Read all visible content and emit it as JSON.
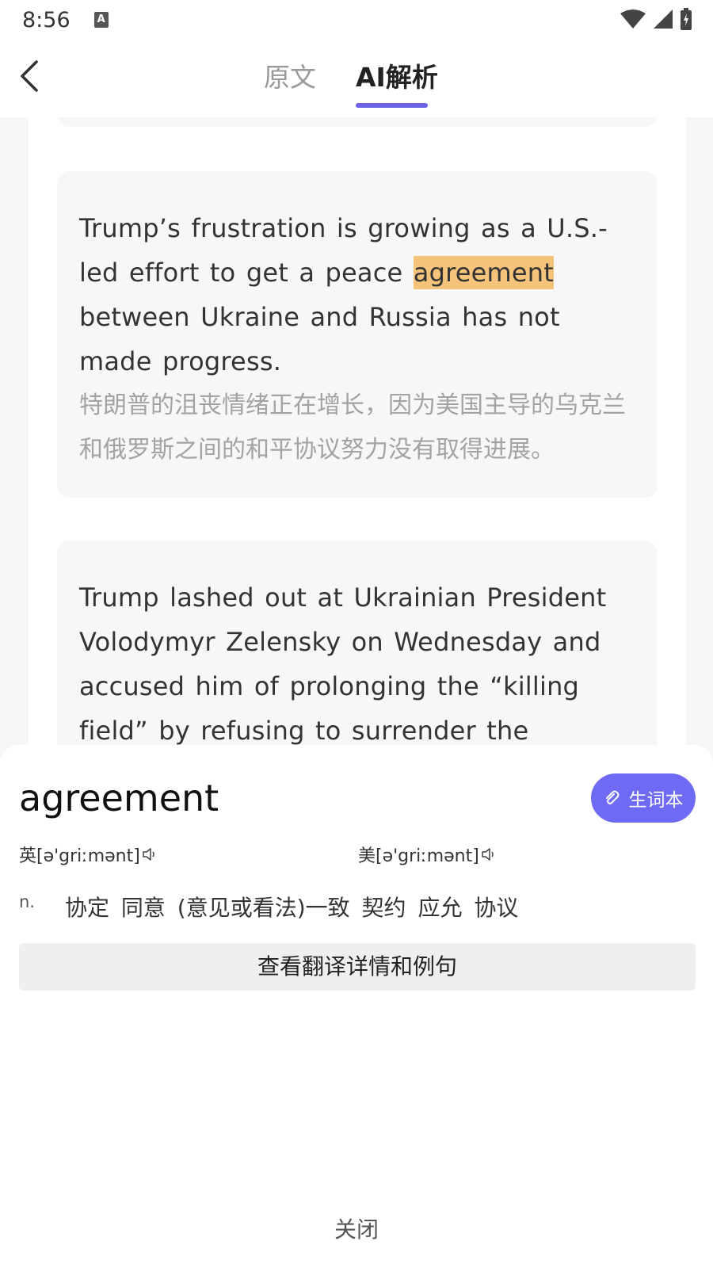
{
  "status_bar": {
    "time": "8:56",
    "notification_icon": "A",
    "icons": [
      "wifi-icon",
      "signal-icon",
      "battery-icon"
    ]
  },
  "header": {
    "tabs": [
      {
        "label": "原文",
        "active": false
      },
      {
        "label": "AI解析",
        "active": true
      }
    ]
  },
  "content": {
    "cards": [
      {
        "en_before": "Trump’s frustration is growing as a U.S.-led effort to get a peace ",
        "en_highlight": "agreement",
        "en_after": " between Ukraine and Russia has not made progress.",
        "zh": "特朗普的沮丧情绪正在增长，因为美国主导的乌克兰和俄罗斯之间的和平协议努力没有取得进展。"
      },
      {
        "en": "Trump lashed out at Ukrainian President Volodymyr Zelensky on Wednesday and accused him of prolonging the “killing field” by refusing to surrender the"
      }
    ]
  },
  "dictionary": {
    "word": "agreement",
    "vocab_button": "生词本",
    "uk_phonetic": "英[ə'griːmənt]",
    "us_phonetic": "美[ə'griːmənt]",
    "part_of_speech": "n.",
    "definitions": "协定 同意 (意见或看法)一致 契约 应允 协议",
    "details_button": "查看翻译详情和例句",
    "close_button": "关闭"
  },
  "colors": {
    "accent": "#6c63e6",
    "highlight": "#f5c37a",
    "card_bg": "#f6f7f9"
  }
}
